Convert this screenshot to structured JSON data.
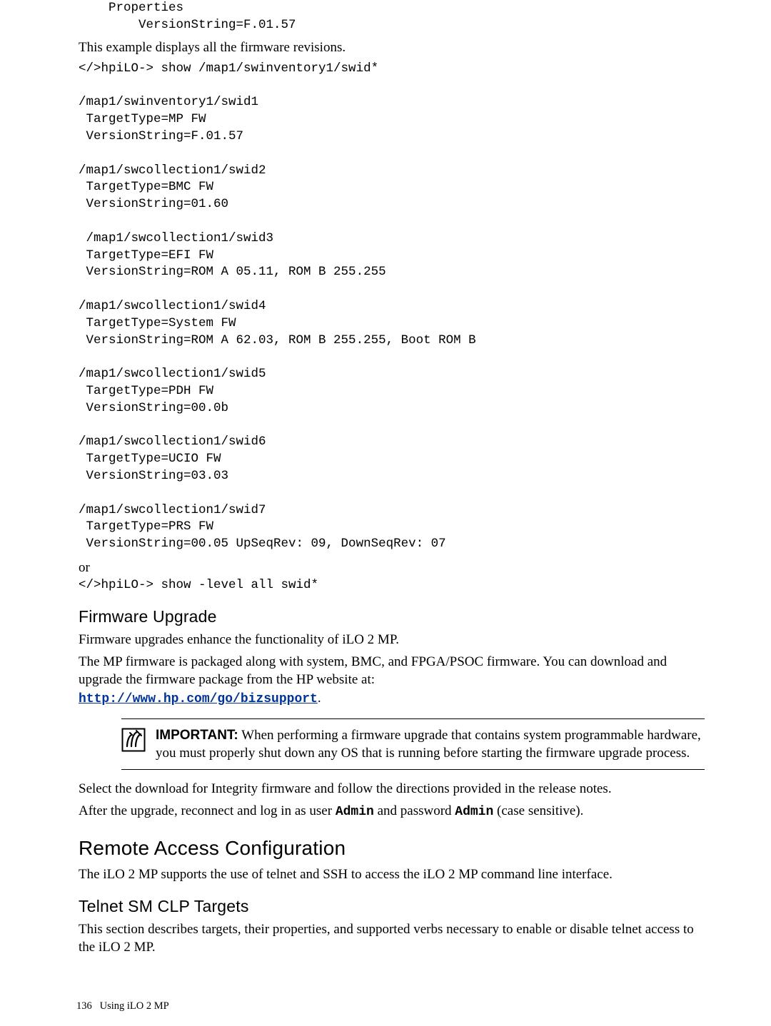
{
  "code_block_top": "    Properties\n        VersionString=F.01.57",
  "intro_line": "This example displays all the firmware revisions.",
  "code_block_main": "</>hpiLO-> show /map1/swinventory1/swid*\n\n/map1/swinventory1/swid1\n TargetType=MP FW\n VersionString=F.01.57\n\n/map1/swcollection1/swid2\n TargetType=BMC FW\n VersionString=01.60\n\n /map1/swcollection1/swid3\n TargetType=EFI FW\n VersionString=ROM A 05.11, ROM B 255.255\n\n/map1/swcollection1/swid4\n TargetType=System FW\n VersionString=ROM A 62.03, ROM B 255.255, Boot ROM B\n\n/map1/swcollection1/swid5\n TargetType=PDH FW\n VersionString=00.0b\n\n/map1/swcollection1/swid6\n TargetType=UCIO FW\n VersionString=03.03\n\n/map1/swcollection1/swid7\n TargetType=PRS FW\n VersionString=00.05 UpSeqRev: 09, DownSeqRev: 07\n",
  "or_label": "or",
  "code_block_alt": "</>hpiLO-> show -level all swid*",
  "h3_firmware_upgrade": "Firmware Upgrade",
  "fw_para1": "Firmware upgrades enhance the functionality of iLO 2 MP.",
  "fw_para2_pre": "The MP firmware is packaged along with system, BMC, and FPGA/PSOC firmware. You can download and upgrade the firmware package from the HP website at: ",
  "fw_link_text": "http://www.hp.com/go/bizsupport",
  "callout": {
    "label": "IMPORTANT:",
    "text": "   When performing a firmware upgrade that contains system programmable hardware, you must properly shut down any OS that is running before starting the firmware upgrade process."
  },
  "fw_para3": "Select the download for Integrity firmware and follow the directions provided in the release notes.",
  "fw_para4_pre": "After the upgrade, reconnect and log in as user ",
  "fw_para4_admin": "Admin",
  "fw_para4_mid": " and password ",
  "fw_para4_post": " (case sensitive).",
  "h2_remote": "Remote Access Configuration",
  "remote_para": "The iLO 2 MP supports the use of telnet and SSH to access the iLO 2 MP command line interface.",
  "h3_telnet": "Telnet SM CLP Targets",
  "telnet_para": "This section describes targets, their properties, and supported verbs necessary to enable or disable telnet access to the iLO 2 MP.",
  "footer": {
    "pagenum": "136",
    "label": "Using iLO 2 MP"
  }
}
